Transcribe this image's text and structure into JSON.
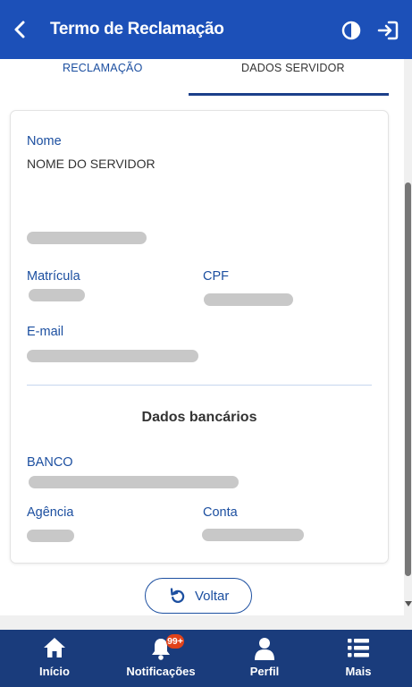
{
  "header": {
    "title": "Termo de Reclamação"
  },
  "tabs": [
    {
      "label": "RECLAMAÇÃO"
    },
    {
      "label": "DADOS SERVIDOR"
    }
  ],
  "servidor": {
    "nome_label": "Nome",
    "nome_value": "NOME DO SERVIDOR",
    "matricula_label": "Matrícula",
    "cpf_label": "CPF",
    "email_label": "E-mail"
  },
  "bancarios": {
    "title": "Dados bancários",
    "banco_label": "BANCO",
    "agencia_label": "Agência",
    "conta_label": "Conta"
  },
  "actions": {
    "voltar": "Voltar"
  },
  "nav": {
    "items": [
      {
        "label": "Início",
        "icon": "home-icon"
      },
      {
        "label": "Notificações",
        "icon": "bell-icon",
        "badge": "99+"
      },
      {
        "label": "Perfil",
        "icon": "user-icon"
      },
      {
        "label": "Mais",
        "icon": "menu-list-icon"
      }
    ]
  },
  "colors": {
    "header": "#1c50b8",
    "nav": "#1a3c7c",
    "accent": "#1c4fa0",
    "badge": "#e0421a"
  }
}
